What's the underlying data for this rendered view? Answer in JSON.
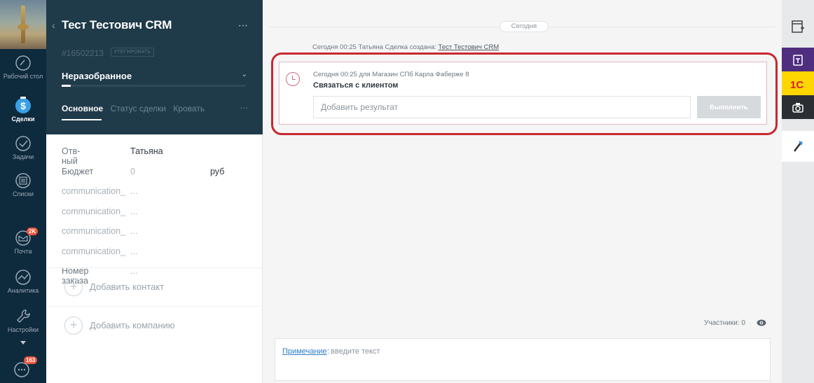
{
  "nav": {
    "items": [
      {
        "label": "Рабочий стол",
        "icon": "dashboard-icon"
      },
      {
        "label": "Сделки",
        "icon": "deals-icon",
        "active": true
      },
      {
        "label": "Задачи",
        "icon": "tasks-icon"
      },
      {
        "label": "Списки",
        "icon": "lists-icon"
      },
      {
        "label": "Почта",
        "icon": "mail-icon",
        "badge": "2K"
      },
      {
        "label": "Аналитика",
        "icon": "analytics-icon"
      },
      {
        "label": "Настройки",
        "icon": "settings-icon"
      }
    ],
    "chat_badge": "163"
  },
  "card": {
    "title": "Тест Тестович CRM",
    "deal_id": "#16502213",
    "tag_label": "#ТЕГИРОВАТЬ",
    "stage": "Неразобранное",
    "stage_progress": 0.05,
    "tabs": [
      "Основное",
      "Статус сделки",
      "Кровать"
    ],
    "fields": [
      {
        "label": "Отв-ный",
        "value": "Татьяна"
      },
      {
        "label": "Бюджет",
        "value": "0",
        "unit": "руб"
      },
      {
        "label": "communication_",
        "value": "..."
      },
      {
        "label": "communication_",
        "value": "..."
      },
      {
        "label": "communication_",
        "value": "..."
      },
      {
        "label": "communication_",
        "value": "..."
      },
      {
        "label": "Номер заказа",
        "value": "..."
      }
    ],
    "add_contact": "Добавить контакт",
    "add_company": "Добавить компанию"
  },
  "feed": {
    "date_label": "Сегодня",
    "system_note_prefix": "Сегодня 00:25 Татьяна Сделка создана:",
    "system_note_link": "Тест Тестович CRM",
    "task": {
      "meta": "Сегодня 00:25 для Магазин СПб Карла Фаберже 8",
      "title": "Связаться с клиентом",
      "input_placeholder": "Добавить результат",
      "button_label": "Выполнить"
    },
    "participants": "Участники: 0",
    "comment_label": "Примечание",
    "comment_placeholder": "введите текст"
  },
  "colors": {
    "nav_bg": "#0e2a3d",
    "card_head_bg": "#1f3a49",
    "highlight": "#c8282f",
    "link": "#2d7cc4"
  }
}
